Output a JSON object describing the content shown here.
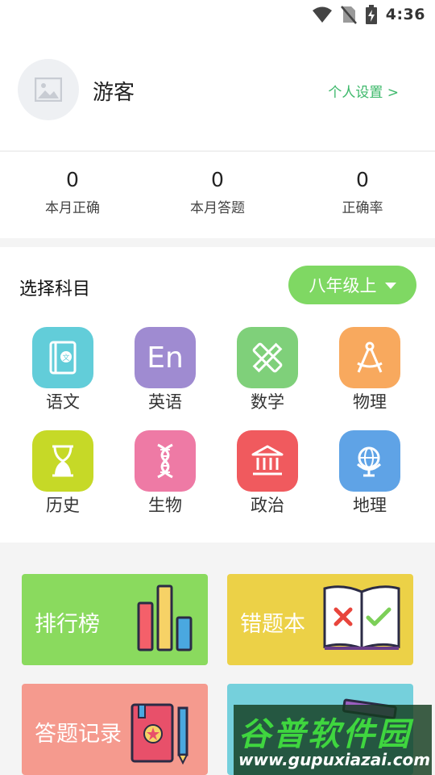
{
  "status_bar": {
    "time": "4:36",
    "icons": [
      "wifi-icon",
      "no-sim-icon",
      "battery-charging-icon"
    ]
  },
  "profile": {
    "username": "游客",
    "settings_link": "个人设置 >",
    "avatar_icon": "image-placeholder-icon"
  },
  "stats": [
    {
      "value": "0",
      "label": "本月正确"
    },
    {
      "value": "0",
      "label": "本月答题"
    },
    {
      "value": "0",
      "label": "正确率"
    }
  ],
  "subjects_section": {
    "title": "选择科目",
    "grade_selector": "八年级上",
    "items": [
      {
        "label": "语文",
        "icon": "book-icon",
        "color": "#62cdd9"
      },
      {
        "label": "英语",
        "icon": "en-text-icon",
        "tile_text": "En",
        "color": "#9f8bd1"
      },
      {
        "label": "数学",
        "icon": "ruler-pencil-icon",
        "color": "#7fd07a"
      },
      {
        "label": "物理",
        "icon": "compass-icon",
        "color": "#f8a95e"
      },
      {
        "label": "历史",
        "icon": "hourglass-icon",
        "color": "#c6d927"
      },
      {
        "label": "生物",
        "icon": "dna-icon",
        "color": "#ee7aa5"
      },
      {
        "label": "政治",
        "icon": "government-building-icon",
        "color": "#f05a5e"
      },
      {
        "label": "地理",
        "icon": "globe-icon",
        "color": "#5fa3e6"
      }
    ]
  },
  "features": [
    {
      "label": "排行榜",
      "icon": "bar-chart-icon",
      "color": "#8ada5e"
    },
    {
      "label": "错题本",
      "icon": "open-book-check-icon",
      "color": "#ecd147"
    },
    {
      "label": "答题记录",
      "icon": "notebook-pencil-icon",
      "color": "#f59a8e"
    },
    {
      "label": "",
      "icon": "books-icon",
      "color": "#75d0dc"
    }
  ],
  "watermark": {
    "title": "谷普软件园",
    "url": "www.gupuxiazai.com"
  }
}
